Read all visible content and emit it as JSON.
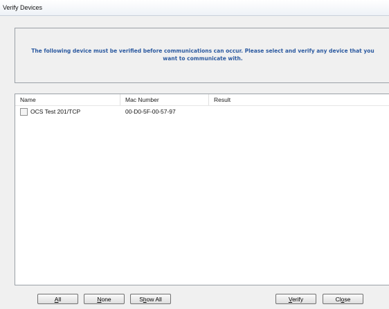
{
  "window": {
    "title": "Verify Devices"
  },
  "banner": {
    "message": "The following device must be verified before communications can occur.  Please select and verify any device that you want to communicate with."
  },
  "list": {
    "columns": [
      "Name",
      "Mac Number",
      "Result"
    ],
    "rows": [
      {
        "checked": false,
        "name": "OCS Test 201/TCP",
        "mac": "00-D0-5F-00-57-97",
        "result": ""
      }
    ]
  },
  "buttons": {
    "all": {
      "mnemonic": "A",
      "rest": "ll"
    },
    "none": {
      "mnemonic": "N",
      "rest": "one"
    },
    "show_all": {
      "before": "S",
      "mnemonic": "h",
      "rest": "ow All"
    },
    "verify": {
      "mnemonic": "V",
      "rest": "erify"
    },
    "close": {
      "before": "Cl",
      "mnemonic": "o",
      "rest": "se"
    }
  }
}
